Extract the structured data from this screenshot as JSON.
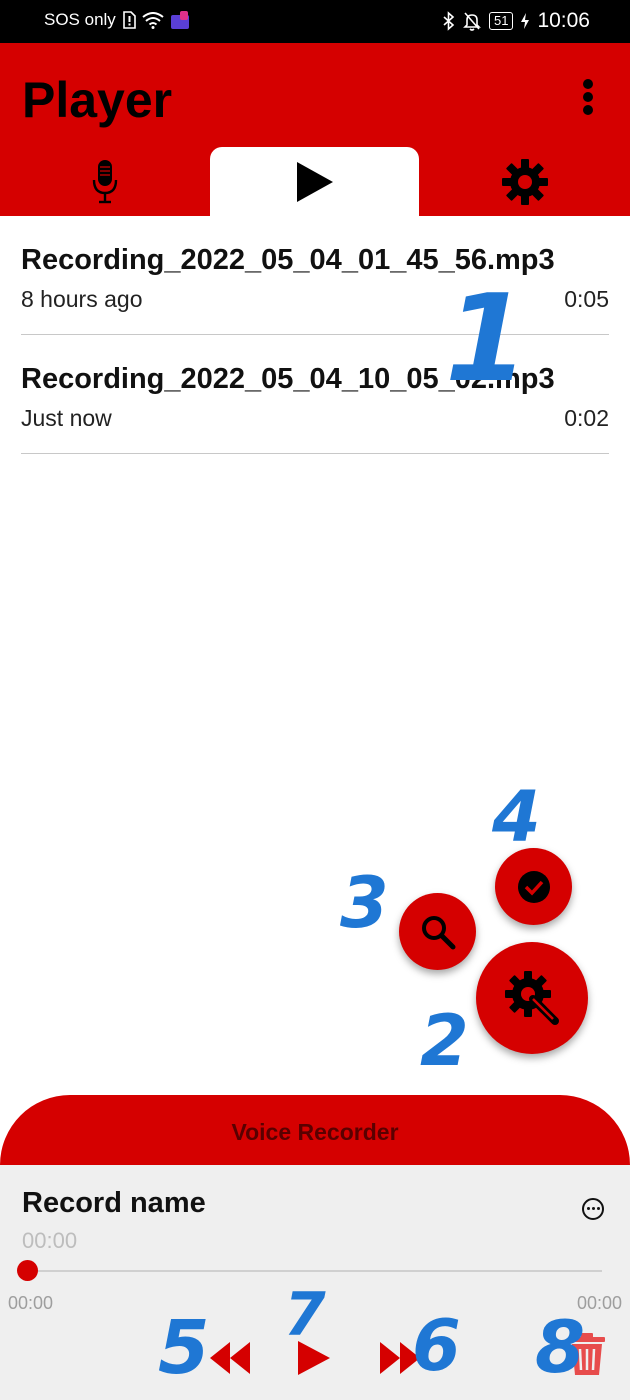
{
  "status_bar": {
    "carrier": "SOS only",
    "battery": "51",
    "time": "10:06",
    "icons": [
      "sim-alert-icon",
      "wifi-icon",
      "app-notification-icon",
      "bluetooth-icon",
      "bell-off-icon",
      "battery-icon",
      "charging-icon"
    ]
  },
  "app_bar": {
    "title": "Player",
    "tabs": [
      {
        "name": "record",
        "icon": "microphone-icon",
        "selected": false
      },
      {
        "name": "player",
        "icon": "play-icon",
        "selected": true
      },
      {
        "name": "settings",
        "icon": "gear-icon",
        "selected": false
      }
    ]
  },
  "recordings": [
    {
      "name": "Recording_2022_05_04_01_45_56.mp3",
      "time": "8 hours ago",
      "duration": "0:05"
    },
    {
      "name": "Recording_2022_05_04_10_05_02.mp3",
      "time": "Just now",
      "duration": "0:02"
    }
  ],
  "fabs": {
    "main_icon": "wrench-gear-icon",
    "search_icon": "search-icon",
    "check_icon": "check-circle-icon"
  },
  "recorder": {
    "title": "Voice Recorder",
    "record_name": "Record name",
    "elapsed": "00:00",
    "start_time": "00:00",
    "end_time": "00:00",
    "progress": 0
  },
  "annotations": [
    "1",
    "2",
    "3",
    "4",
    "5",
    "6",
    "7",
    "8"
  ],
  "colors": {
    "accent": "#d50000",
    "annotation": "#1f77d4"
  }
}
